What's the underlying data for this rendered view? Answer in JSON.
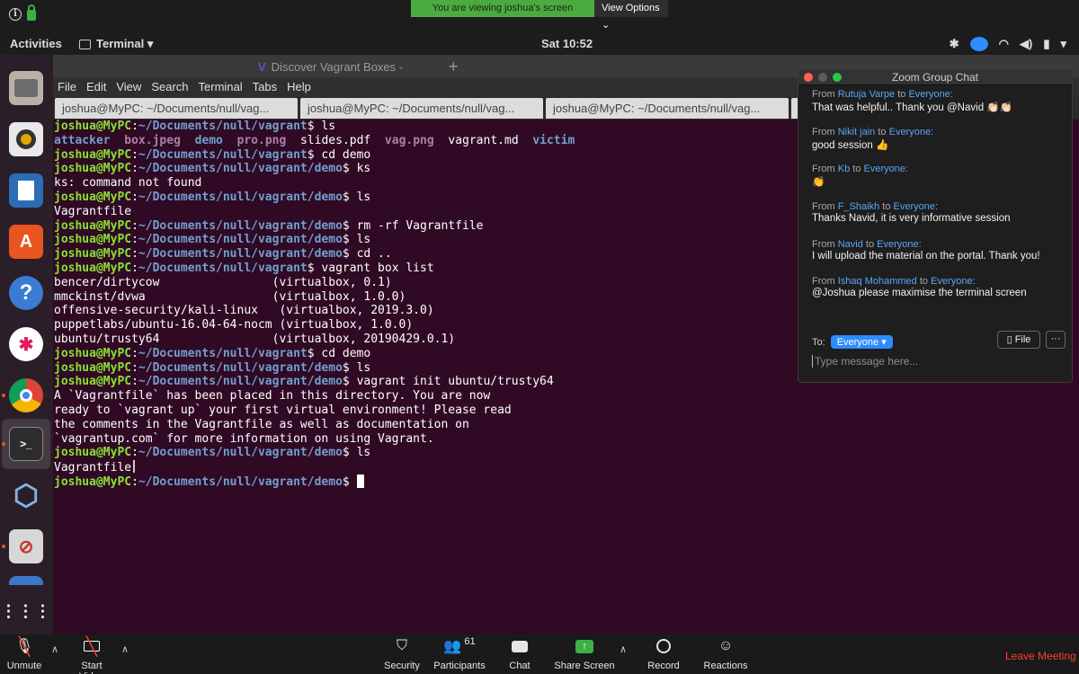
{
  "zoom_top": {
    "banner": "You are viewing joshua's screen",
    "view_options": "View Options ⌄"
  },
  "topbar": {
    "activities": "Activities",
    "app_name": "Terminal ▾",
    "clock": "Sat 10:52"
  },
  "terminal": {
    "browser_tab": "Discover Vagrant Boxes -",
    "menu": [
      "File",
      "Edit",
      "View",
      "Search",
      "Terminal",
      "Tabs",
      "Help"
    ],
    "tabs": [
      "joshua@MyPC: ~/Documents/null/vag...",
      "joshua@MyPC: ~/Documents/null/vag...",
      "joshua@MyPC: ~/Documents/null/vag..."
    ],
    "prompt_user": "joshua@MyPC",
    "lines": [
      {
        "kind": "cmd",
        "path": "~/Documents/null/vagrant",
        "cmd": "ls"
      },
      {
        "kind": "ls"
      },
      {
        "kind": "cmd",
        "path": "~/Documents/null/vagrant",
        "cmd": "cd demo"
      },
      {
        "kind": "cmd",
        "path": "~/Documents/null/vagrant/demo",
        "cmd": "ks"
      },
      {
        "kind": "out",
        "text": "ks: command not found"
      },
      {
        "kind": "cmd",
        "path": "~/Documents/null/vagrant/demo",
        "cmd": "ls"
      },
      {
        "kind": "out",
        "text": "Vagrantfile"
      },
      {
        "kind": "cmd",
        "path": "~/Documents/null/vagrant/demo",
        "cmd": "rm -rf Vagrantfile"
      },
      {
        "kind": "cmd",
        "path": "~/Documents/null/vagrant/demo",
        "cmd": "ls"
      },
      {
        "kind": "cmd",
        "path": "~/Documents/null/vagrant/demo",
        "cmd": "cd .."
      },
      {
        "kind": "cmd",
        "path": "~/Documents/null/vagrant",
        "cmd": "vagrant box list"
      },
      {
        "kind": "out",
        "text": "bencer/dirtycow                (virtualbox, 0.1)"
      },
      {
        "kind": "out",
        "text": "mmckinst/dvwa                  (virtualbox, 1.0.0)"
      },
      {
        "kind": "out",
        "text": "offensive-security/kali-linux   (virtualbox, 2019.3.0)"
      },
      {
        "kind": "out",
        "text": "puppetlabs/ubuntu-16.04-64-nocm (virtualbox, 1.0.0)"
      },
      {
        "kind": "out",
        "text": "ubuntu/trusty64                (virtualbox, 20190429.0.1)"
      },
      {
        "kind": "cmd",
        "path": "~/Documents/null/vagrant",
        "cmd": "cd demo"
      },
      {
        "kind": "cmd",
        "path": "~/Documents/null/vagrant/demo",
        "cmd": "ls"
      },
      {
        "kind": "cmd",
        "path": "~/Documents/null/vagrant/demo",
        "cmd": "vagrant init ubuntu/trusty64"
      },
      {
        "kind": "out",
        "text": "A `Vagrantfile` has been placed in this directory. You are now"
      },
      {
        "kind": "out",
        "text": "ready to `vagrant up` your first virtual environment! Please read"
      },
      {
        "kind": "out",
        "text": "the comments in the Vagrantfile as well as documentation on"
      },
      {
        "kind": "out",
        "text": "`vagrantup.com` for more information on using Vagrant."
      },
      {
        "kind": "cmd",
        "path": "~/Documents/null/vagrant/demo",
        "cmd": "ls"
      },
      {
        "kind": "out",
        "text": "Vagrantfile",
        "ibeam": true
      },
      {
        "kind": "cmd",
        "path": "~/Documents/null/vagrant/demo",
        "cmd": "",
        "cursor": true
      }
    ],
    "ls_items": [
      {
        "text": "attacker",
        "cls": "dir"
      },
      {
        "text": "box.jpeg",
        "cls": "img"
      },
      {
        "text": "demo",
        "cls": "dir"
      },
      {
        "text": "pro.png",
        "cls": "img"
      },
      {
        "text": "slides.pdf",
        "cls": ""
      },
      {
        "text": "vag.png",
        "cls": "img"
      },
      {
        "text": "vagrant.md",
        "cls": ""
      },
      {
        "text": "victim",
        "cls": "dir"
      }
    ]
  },
  "chat": {
    "title": "Zoom Group Chat",
    "messages": [
      {
        "from": "Rutuja Varpe",
        "to": "Everyone:",
        "text": "That was helpful.. Thank you @Navid 👏🏻👏🏻"
      },
      {
        "from": "Nikit jain",
        "to": "Everyone:",
        "text": "good session 👍"
      },
      {
        "from": "Kb",
        "to": "Everyone:",
        "text": "👏"
      },
      {
        "from": "F_Shaikh",
        "to": "Everyone:",
        "text": "Thanks Navid, it is very informative session"
      },
      {
        "from": "Navid",
        "to": "Everyone:",
        "text": "I will upload the material on the portal. Thank you!"
      },
      {
        "from": "Ishaq Mohammed",
        "to": "Everyone:",
        "text": "@Joshua please maximise the terminal screen"
      }
    ],
    "from_word": "From",
    "to_word": "to",
    "to_label": "To:",
    "recipient": "Everyone ▾",
    "file_label": "File",
    "more_label": "···",
    "input_placeholder": "Type message here..."
  },
  "bottom_bar": {
    "unmute": "Unmute",
    "start_video": "Start Video",
    "security": "Security",
    "participants": "Participants",
    "participants_count": "61",
    "chat": "Chat",
    "share_screen": "Share Screen",
    "record": "Record",
    "reactions": "Reactions",
    "leave": "Leave Meeting"
  }
}
